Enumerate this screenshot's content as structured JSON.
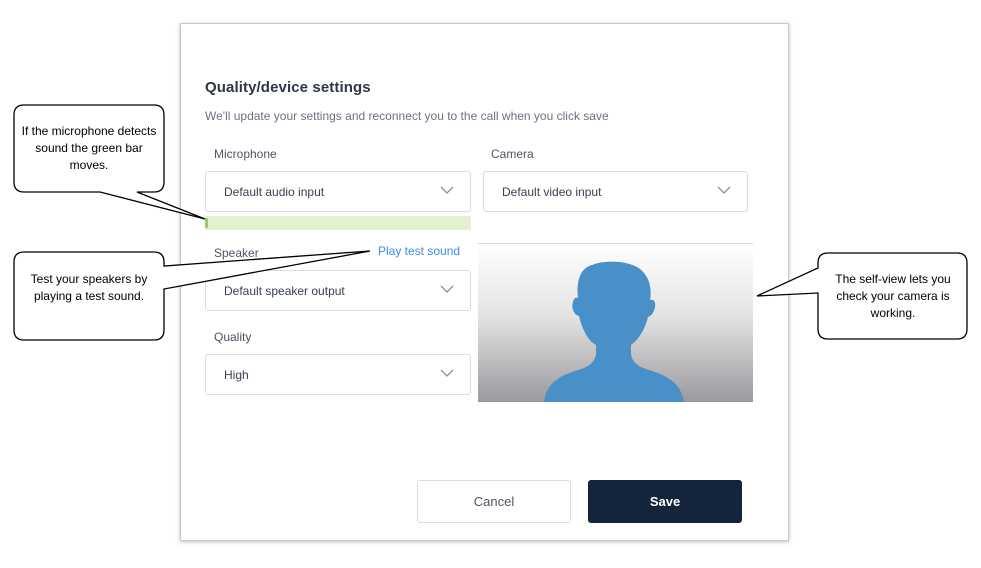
{
  "dialog": {
    "title": "Quality/device settings",
    "subtitle": "We'll update your settings and reconnect you to the call when you click save",
    "microphone": {
      "label": "Microphone",
      "value": "Default audio input",
      "level": 0.01
    },
    "camera": {
      "label": "Camera",
      "value": "Default video input"
    },
    "speaker": {
      "label": "Speaker",
      "value": "Default speaker output",
      "test_link": "Play test sound"
    },
    "quality": {
      "label": "Quality",
      "value": "High"
    },
    "buttons": {
      "cancel": "Cancel",
      "save": "Save"
    }
  },
  "callouts": {
    "microphone": "If the microphone detects sound the green bar moves.",
    "speaker": "Test your speakers by playing a test sound.",
    "selfview": "The self-view lets you check your camera is working."
  },
  "colors": {
    "accent_link": "#3b8fe6",
    "save_button": "#14243b",
    "level_bar_bg": "#e3f1cf",
    "level_bar_fill": "#9bc96a",
    "avatar": "#4a90c8"
  },
  "icons": {
    "select_chevron": "chevron-down-icon",
    "self_view": "person-silhouette-icon"
  }
}
